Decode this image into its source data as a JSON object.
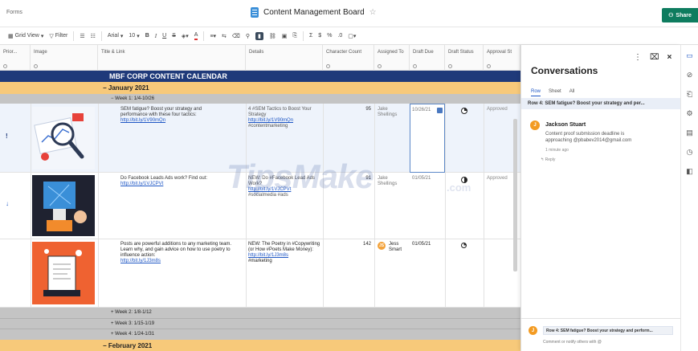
{
  "app": {
    "forms_link": "Forms",
    "doc_title": "Content Management Board",
    "share_label": "Share"
  },
  "toolbar": {
    "grid_view": "Grid View",
    "filter": "Filter",
    "font": "Arial",
    "font_size": "10",
    "bold": "B",
    "italic": "I",
    "underline": "U",
    "strike": "S",
    "text_color": "A",
    "sum": "Σ",
    "currency": "$",
    "percent": "%"
  },
  "columns": [
    {
      "label": "Prior..."
    },
    {
      "label": "Image"
    },
    {
      "label": "Title & Link"
    },
    {
      "label": "Details"
    },
    {
      "label": "Character Count"
    },
    {
      "label": "Assigned To"
    },
    {
      "label": "Draft Due"
    },
    {
      "label": "Draft Status"
    },
    {
      "label": "Approval St"
    }
  ],
  "banner": "MBF CORP CONTENT CALENDAR",
  "months": [
    "January 2021",
    "February 2021"
  ],
  "weeks": [
    "Week 1: 1/4-10/26",
    "Week 2: 1/8-1/12",
    "Week 3: 1/15-1/19",
    "Week 4: 1/24-1/31"
  ],
  "rows": [
    {
      "priority": "!",
      "title": "SEM fatigue? Boost your strategy and performance with these four tactics:",
      "title_link": "http://bit.ly/1V90mQn",
      "details": "4 #SEM Tactics to Boost Your Strategy",
      "details_link": "http://bit.ly/1V90mQn",
      "details_tag": "#contentmarketing",
      "char_count": "95",
      "assigned": "Jake Shellings",
      "draft_due": "10/26/21",
      "approval": "Approved"
    },
    {
      "priority": "↓",
      "title": "Do Facebook Leads Ads work? Find out:",
      "title_link": "http://bit.ly/1VJCPVt",
      "details": "NEW: Do #Facebook Lead Ads Work?",
      "details_link": "http://bit.ly/1VJCPVt",
      "details_tag": "#socialmedia #ads",
      "char_count": "91",
      "assigned": "Jake Shellings",
      "draft_due": "01/05/21",
      "approval": "Approved"
    },
    {
      "priority": "",
      "title": "Posts are powerful additions to any marketing team. Learn why, and gain advice on how to use poetry to influence action:",
      "title_link": "http://bit.ly/1J3m8s",
      "details": "NEW: The Poetry in #Copywriting (or How #Poets Make Money):",
      "details_link": "http://bit.ly/1J3m8s",
      "details_tag": "#marketing",
      "char_count": "142",
      "assigned": "Jess Smart",
      "assigned_initials": "JS",
      "draft_due": "01/05/21",
      "approval": ""
    }
  ],
  "panel": {
    "title": "Conversations",
    "tabs": [
      "Row",
      "Sheet",
      "All"
    ],
    "row_header": "Row 4: SEM fatigue? Boost your strategy and per...",
    "comment_author": "Jackson Stuart",
    "comment_initials": "J",
    "comment_text": "Content proof submission deadline is approaching @pbabev2014@gmail.com",
    "comment_time": "1 minute ago",
    "reply_label": "Reply",
    "compose_header": "Row 4: SEM fatigue? Boost your strategy and perform...",
    "compose_placeholder": "Comment or notify others with @"
  },
  "watermark": {
    "main": "TipsMake",
    "suffix": ".com"
  },
  "colors": {
    "banner": "#1f3a7a",
    "month": "#f7c97a",
    "week": "#c4c4c4",
    "share": "#0e7c5f",
    "link": "#1f57c5"
  }
}
